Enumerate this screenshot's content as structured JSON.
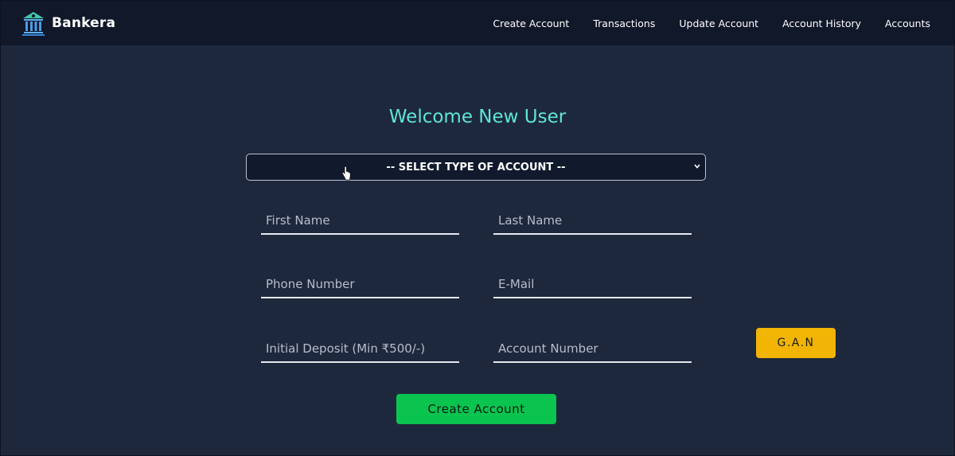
{
  "brand": {
    "name": "Bankera",
    "icon": "bank-icon"
  },
  "nav": {
    "items": [
      "Create Account",
      "Transactions",
      "Update Account",
      "Account History",
      "Accounts"
    ]
  },
  "form": {
    "title": "Welcome New User",
    "account_type_select": {
      "selected": "-- SELECT TYPE OF ACCOUNT --"
    },
    "fields": {
      "first_name": {
        "placeholder": "First Name",
        "value": ""
      },
      "last_name": {
        "placeholder": "Last Name",
        "value": ""
      },
      "phone_number": {
        "placeholder": "Phone Number",
        "value": ""
      },
      "email": {
        "placeholder": "E-Mail",
        "value": ""
      },
      "initial_deposit": {
        "placeholder": "Initial Deposit (Min ₹500/-)",
        "value": ""
      },
      "account_number": {
        "placeholder": "Account Number",
        "value": ""
      }
    },
    "gan_label": "G.A.N",
    "submit_label": "Create Account"
  },
  "colors": {
    "page_bg": "#1e283d",
    "navbar_bg": "#11182a",
    "title": "#5fe6d6",
    "gan_button": "#f2b405",
    "create_button": "#0ac44f"
  }
}
